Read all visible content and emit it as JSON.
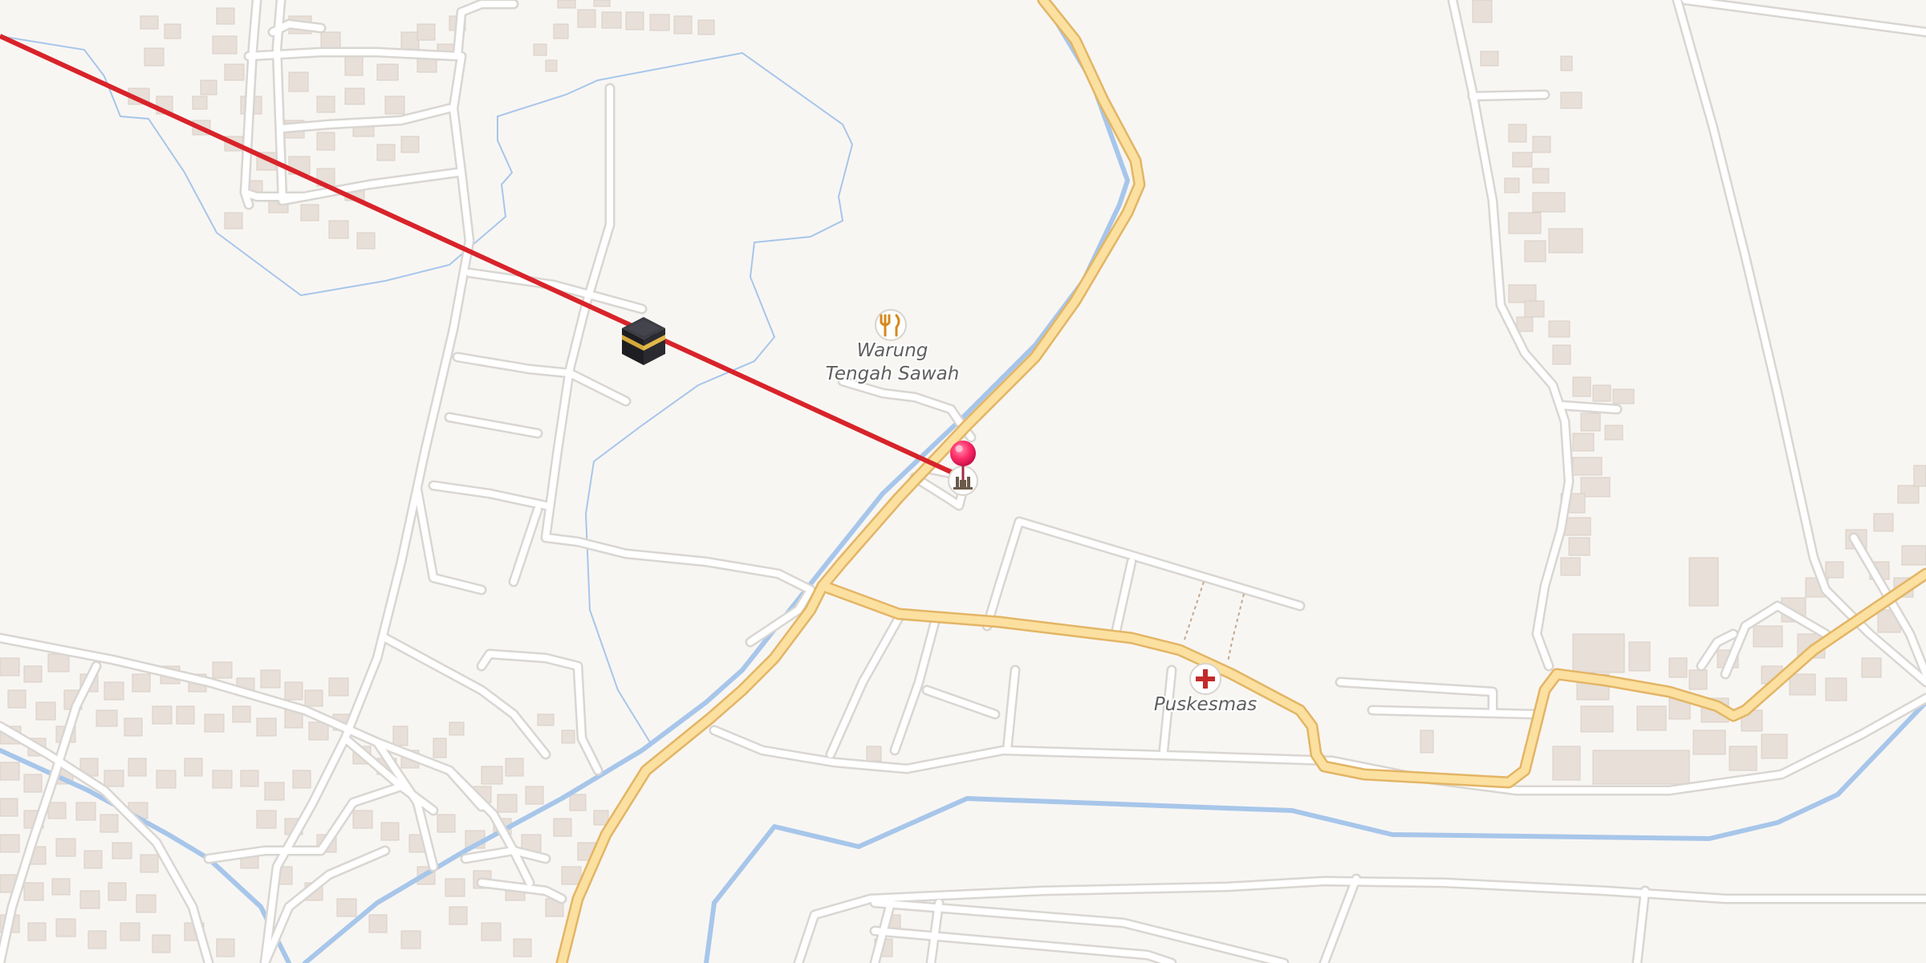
{
  "map": {
    "background_color": "#f8f6f3",
    "road_color": "#ffffff",
    "road_casing_color": "#d9d6d2",
    "main_road_color": "#fbe0a0",
    "main_road_casing_color": "#e3b565",
    "water_color": "#a7c6ea",
    "building_color": "#e7dfd8",
    "qibla_line_color": "#d8232a",
    "pin_color": "#ff2d6a",
    "pois": [
      {
        "name": "Warung",
        "name_line2": "Tengah Sawah",
        "category": "restaurant",
        "icon": "fork-knife-icon"
      },
      {
        "name": "Puskesmas",
        "category": "clinic",
        "icon": "medical-cross-icon"
      },
      {
        "name": "",
        "category": "mosque",
        "icon": "mosque-icon"
      }
    ],
    "qibla": {
      "icon": "kaaba-icon",
      "description_icon": "location-pin-icon"
    }
  }
}
